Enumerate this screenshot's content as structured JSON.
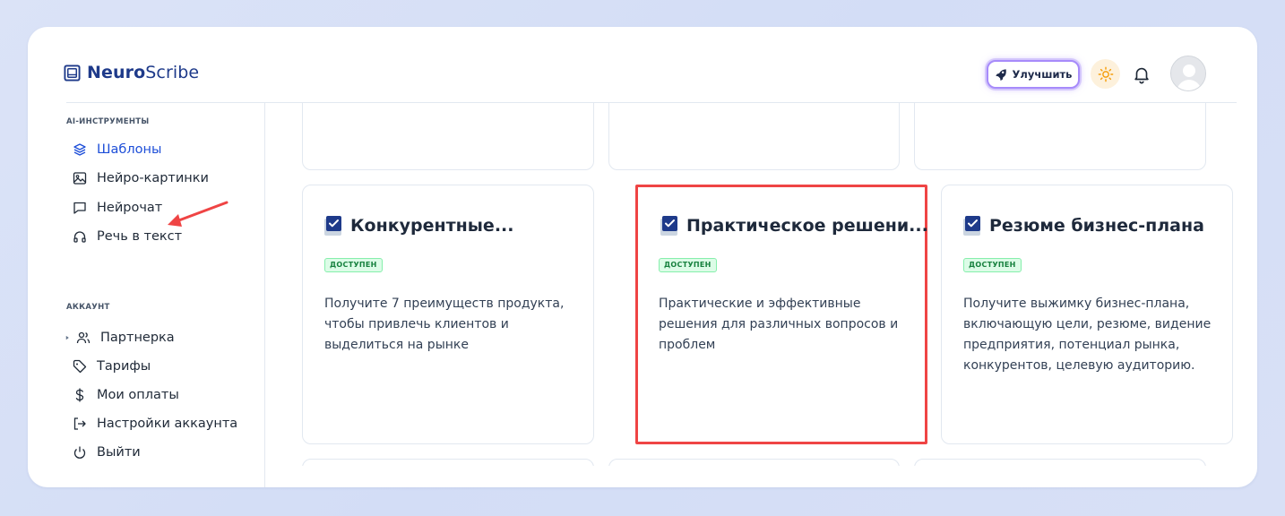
{
  "app": {
    "logo_bold": "Neuro",
    "logo_light": "Scribe"
  },
  "header": {
    "upgrade_label": "Улучшить",
    "icons": [
      "rocket-icon",
      "sun-icon",
      "bell-icon",
      "avatar"
    ]
  },
  "sidebar": {
    "sections": [
      {
        "label": "AI-ИНСТРУМЕНТЫ",
        "items": [
          {
            "label": "Шаблоны",
            "icon": "layers-icon",
            "active": true
          },
          {
            "label": "Нейро-картинки",
            "icon": "image-icon"
          },
          {
            "label": "Нейрочат",
            "icon": "chat-icon"
          },
          {
            "label": "Речь в текст",
            "icon": "headphones-icon"
          }
        ]
      },
      {
        "label": "АККАУНТ",
        "items": [
          {
            "label": "Партнерка",
            "icon": "users-icon",
            "expandable": true
          },
          {
            "label": "Тарифы",
            "icon": "tag-icon"
          },
          {
            "label": "Мои оплаты",
            "icon": "dollar-icon"
          },
          {
            "label": "Настройки аккаунта",
            "icon": "logout-arrow-icon"
          },
          {
            "label": "Выйти",
            "icon": "power-icon"
          }
        ]
      }
    ]
  },
  "cards": [
    {
      "title": "Конкурентные...",
      "badge": "ДОСТУПЕН",
      "description": "Получите 7 преимуществ продукта, чтобы привлечь клиентов и выделиться на рынке"
    },
    {
      "title": "Практическое решени...",
      "badge": "ДОСТУПЕН",
      "description": "Практические и эффективные решения для различных вопросов и проблем",
      "highlighted": true
    },
    {
      "title": "Резюме бизнес-плана",
      "badge": "ДОСТУПЕН",
      "description": "Получите выжимку бизнес-плана, включающую цели, резюме, видение предприятия, потенциал рынка, конкурентов, целевую аудиторию."
    }
  ],
  "colors": {
    "accent": "#1d4ed8",
    "badge_bg": "#dcfce7",
    "badge_text": "#15803d",
    "highlight_border": "#ef4444",
    "upgrade_glow": "#a78bfa"
  }
}
